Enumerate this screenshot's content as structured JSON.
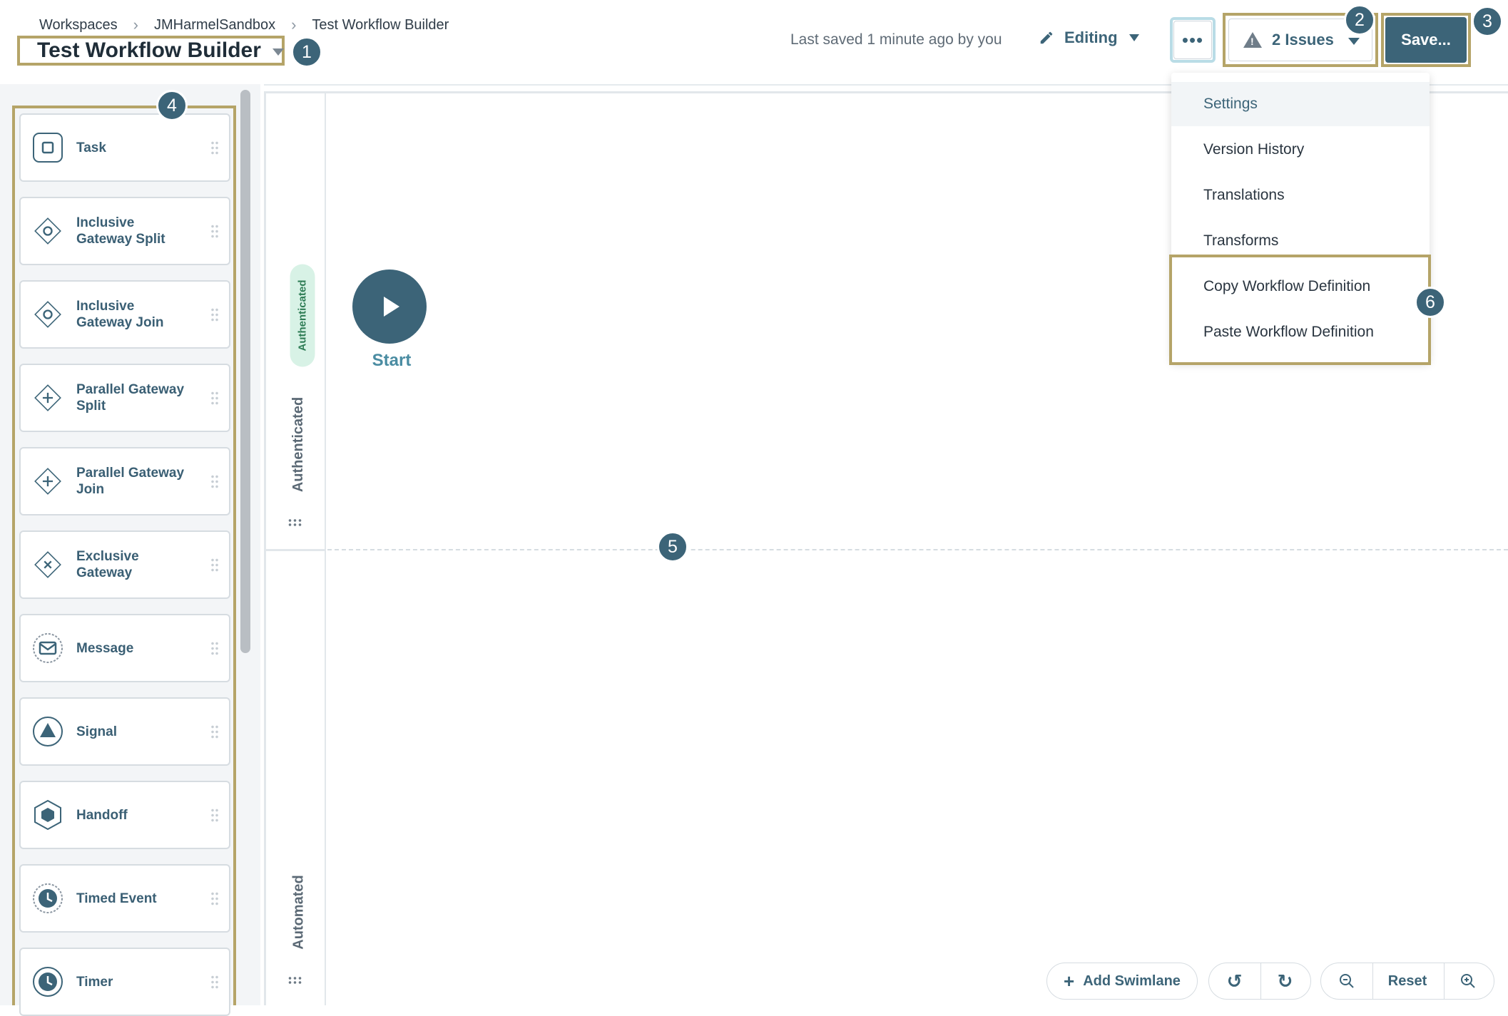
{
  "breadcrumb": [
    "Workspaces",
    "JMHarmelSandbox",
    "Test Workflow Builder"
  ],
  "title": "Test Workflow Builder",
  "last_saved": "Last saved 1 minute ago by you",
  "editing_label": "Editing",
  "issues_label": "2 Issues",
  "save_label": "Save...",
  "callouts": [
    "1",
    "2",
    "3",
    "4",
    "5",
    "6"
  ],
  "palette": [
    {
      "label": "Task",
      "icon": "task-square-icon"
    },
    {
      "label": "Inclusive Gateway Split",
      "icon": "gateway-circle-icon"
    },
    {
      "label": "Inclusive Gateway Join",
      "icon": "gateway-circle-icon"
    },
    {
      "label": "Parallel Gateway Split",
      "icon": "gateway-plus-icon"
    },
    {
      "label": "Parallel Gateway Join",
      "icon": "gateway-plus-icon"
    },
    {
      "label": "Exclusive Gateway",
      "icon": "gateway-x-icon"
    },
    {
      "label": "Message",
      "icon": "envelope-icon"
    },
    {
      "label": "Signal",
      "icon": "triangle-icon"
    },
    {
      "label": "Handoff",
      "icon": "hexagon-icon"
    },
    {
      "label": "Timed Event",
      "icon": "clock-dashed-icon"
    },
    {
      "label": "Timer",
      "icon": "clock-icon"
    }
  ],
  "lanes": {
    "badge": "Authenticated",
    "lane1": "Authenticated",
    "lane2": "Automated"
  },
  "start_label": "Start",
  "menu": [
    "Settings",
    "Version History",
    "Translations",
    "Transforms",
    "Copy Workflow Definition",
    "Paste Workflow Definition"
  ],
  "toolbar": {
    "add_swimlane": "Add Swimlane",
    "reset": "Reset"
  },
  "colors": {
    "primary": "#3c6478",
    "callout_outline": "#b5a468",
    "lane_badge_bg": "#d8f2e6"
  }
}
